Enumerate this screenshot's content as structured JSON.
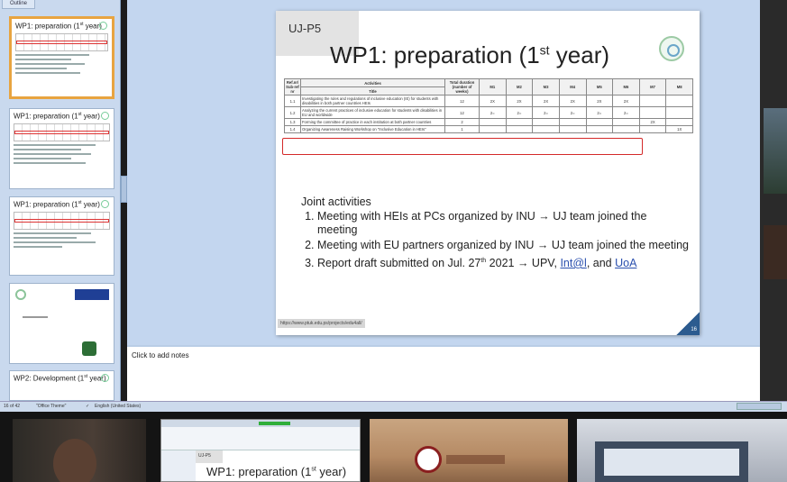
{
  "thumbnail_pane": {
    "outline_tab": "Outline",
    "thumbnails": [
      {
        "title": "WP1: preparation (1",
        "sup": "st",
        "suffix": " year)"
      },
      {
        "title": "WP1: preparation (1",
        "sup": "st",
        "suffix": " year)"
      },
      {
        "title": "WP1: preparation (1",
        "sup": "st",
        "suffix": " year)"
      },
      {
        "title": "WP2: Development (1",
        "sup": "st",
        "suffix": " year)"
      }
    ]
  },
  "slide": {
    "code": "UJ-P5",
    "title_main": "WP1: preparation (1",
    "title_sup": "st",
    "title_end": " year)",
    "table": {
      "group_headers": {
        "ref": "Ref.nr/ Sub-ref nr",
        "activities": "Activities",
        "title": "Title",
        "duration": "Total duration (number of weeks)"
      },
      "months": [
        "M1",
        "M2",
        "M3",
        "M4",
        "M5",
        "M6",
        "M7",
        "M8"
      ],
      "rows": [
        {
          "ref": "1.1",
          "title": "Investigating the rules and regulations of inclusive education (IE) for students with disabilities in both partner countries HEIs",
          "duration": "12",
          "cells": [
            "2X",
            "2X",
            "2X",
            "2X",
            "2X",
            "2X",
            "",
            ""
          ]
        },
        {
          "ref": "1.2",
          "title": "Analyzing the current practices of inclusive education for students with disabilities in EU and worldwide",
          "duration": "12",
          "cells": [
            "2=",
            "2=",
            "2=",
            "2=",
            "2=",
            "2=",
            "",
            ""
          ]
        },
        {
          "ref": "1.3",
          "title": "Forming the committee of practice in each institution at both partner countries",
          "duration": "2",
          "cells": [
            "",
            "",
            "",
            "",
            "",
            "",
            "2X",
            ""
          ]
        },
        {
          "ref": "1.4",
          "title": "Organizing Awareness Raising Workshop on \"Inclusive Education in HEIs\"",
          "duration": "1",
          "cells": [
            "",
            "",
            "",
            "",
            "",
            "",
            "",
            "1X"
          ]
        }
      ]
    },
    "joint_heading": "Joint activities",
    "bullets": [
      "Meeting with HEIs at PCs organized by INU → UJ team joined the meeting",
      "Meeting with EU partners organized by INU → UJ team joined the meeting"
    ],
    "bullet3_pre": "Report draft submitted on Jul. 27",
    "bullet3_sup": "th",
    "bullet3_mid": " 2021 → UPV, ",
    "bullet3_link1": "Int@l",
    "bullet3_and": ", and ",
    "bullet3_link2": "UoA",
    "url": "https://www.ptuk.edu.ps/projects/edu4all/",
    "number": "16"
  },
  "notes": {
    "placeholder": "Click to add notes"
  },
  "status_bar": {
    "slide_counter": "16 of 42",
    "theme": "\"Office Theme\"",
    "language": "English (United States)"
  },
  "participant_strip": {
    "shared_screen_code": "UJ-P5",
    "shared_screen_title": "WP1: preparation (1",
    "shared_screen_sup": "st",
    "shared_screen_end": " year)"
  },
  "colors": {
    "highlight_red": "#d42a2a",
    "accent_blue": "#2c5b8f",
    "pane_blue": "#c9d9ee"
  }
}
